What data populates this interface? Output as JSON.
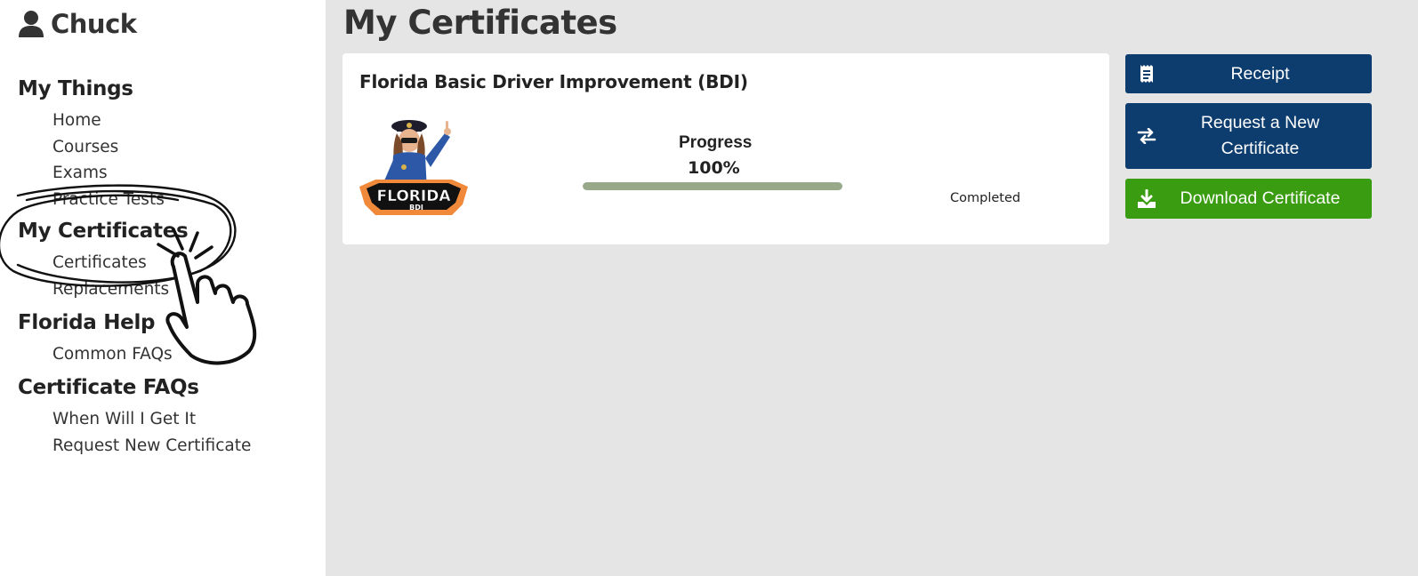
{
  "user": {
    "name": "Chuck",
    "icon": "user-icon"
  },
  "nav": [
    {
      "heading": "My Things",
      "items": [
        "Home",
        "Courses",
        "Exams",
        "Practice Tests"
      ]
    },
    {
      "heading": "My Certificates",
      "items": [
        "Certificates",
        "Replacements"
      ]
    },
    {
      "heading": "Florida Help",
      "items": [
        "Common FAQs"
      ]
    },
    {
      "heading": "Certificate FAQs",
      "items": [
        "When Will I Get It",
        "Request New Certificate"
      ]
    }
  ],
  "page": {
    "title": "My Certificates"
  },
  "course": {
    "title": "Florida Basic Driver Improvement (BDI)",
    "logo": {
      "text": "FLORIDA",
      "subtext": "BDI"
    },
    "progress_label": "Progress",
    "progress_value": "100%",
    "progress_fraction": 1.0,
    "status": "Completed"
  },
  "actions": {
    "receipt": {
      "label": "Receipt",
      "icon": "receipt-icon"
    },
    "request": {
      "label": "Request a New Certificate",
      "icon": "swap-arrows-icon"
    },
    "download": {
      "label": "Download Certificate",
      "icon": "download-icon"
    }
  },
  "colors": {
    "primary_button": "#0d3d6e",
    "download_button": "#3a9c10",
    "progress_fill": "#98a98a",
    "page_background": "#e5e5e5"
  }
}
